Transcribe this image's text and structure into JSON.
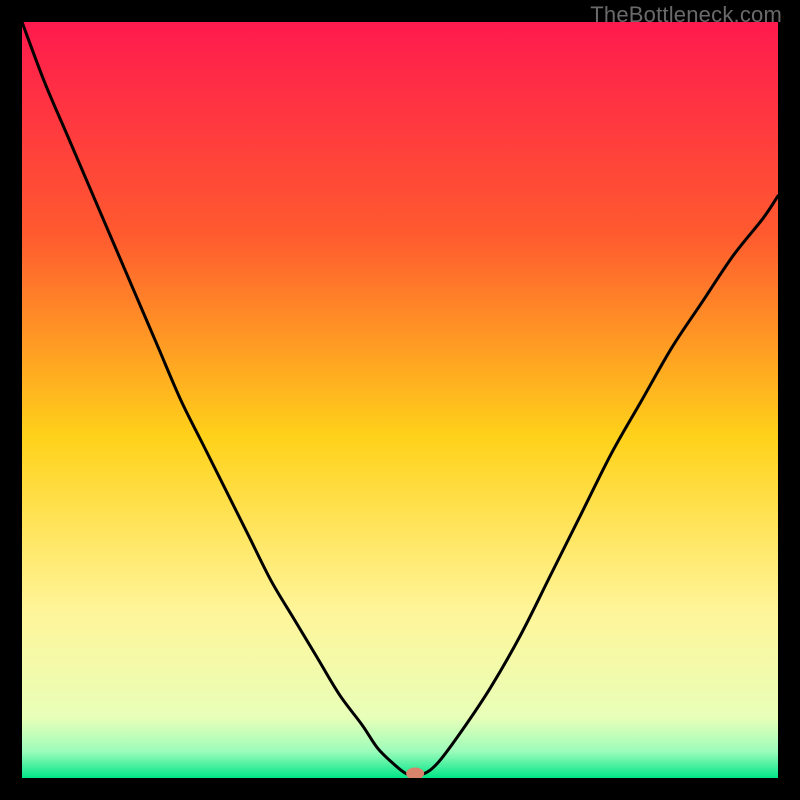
{
  "watermark": "TheBottleneck.com",
  "chart_data": {
    "type": "line",
    "title": "",
    "xlabel": "",
    "ylabel": "",
    "xlim": [
      0,
      100
    ],
    "ylim": [
      0,
      100
    ],
    "background_gradient": {
      "stops": [
        {
          "offset": 0.0,
          "color": "#ff1a4e"
        },
        {
          "offset": 0.28,
          "color": "#ff5a2f"
        },
        {
          "offset": 0.55,
          "color": "#ffd21a"
        },
        {
          "offset": 0.78,
          "color": "#fff59a"
        },
        {
          "offset": 0.92,
          "color": "#e8ffb8"
        },
        {
          "offset": 0.965,
          "color": "#9cfcbb"
        },
        {
          "offset": 1.0,
          "color": "#00e587"
        }
      ]
    },
    "series": [
      {
        "name": "bottleneck-curve",
        "color": "#000000",
        "x": [
          0,
          3,
          6,
          9,
          12,
          15,
          18,
          21,
          24,
          27,
          30,
          33,
          36,
          39,
          42,
          45,
          47,
          49,
          51,
          53,
          55,
          58,
          62,
          66,
          70,
          74,
          78,
          82,
          86,
          90,
          94,
          98,
          100
        ],
        "y": [
          100,
          92,
          85,
          78,
          71,
          64,
          57,
          50,
          44,
          38,
          32,
          26,
          21,
          16,
          11,
          7,
          4,
          2,
          0.5,
          0.5,
          2,
          6,
          12,
          19,
          27,
          35,
          43,
          50,
          57,
          63,
          69,
          74,
          77
        ]
      }
    ],
    "marker": {
      "name": "optimal-point",
      "x": 52,
      "y": 0.6,
      "color": "#d8836c",
      "rx": 9,
      "ry": 6
    }
  }
}
